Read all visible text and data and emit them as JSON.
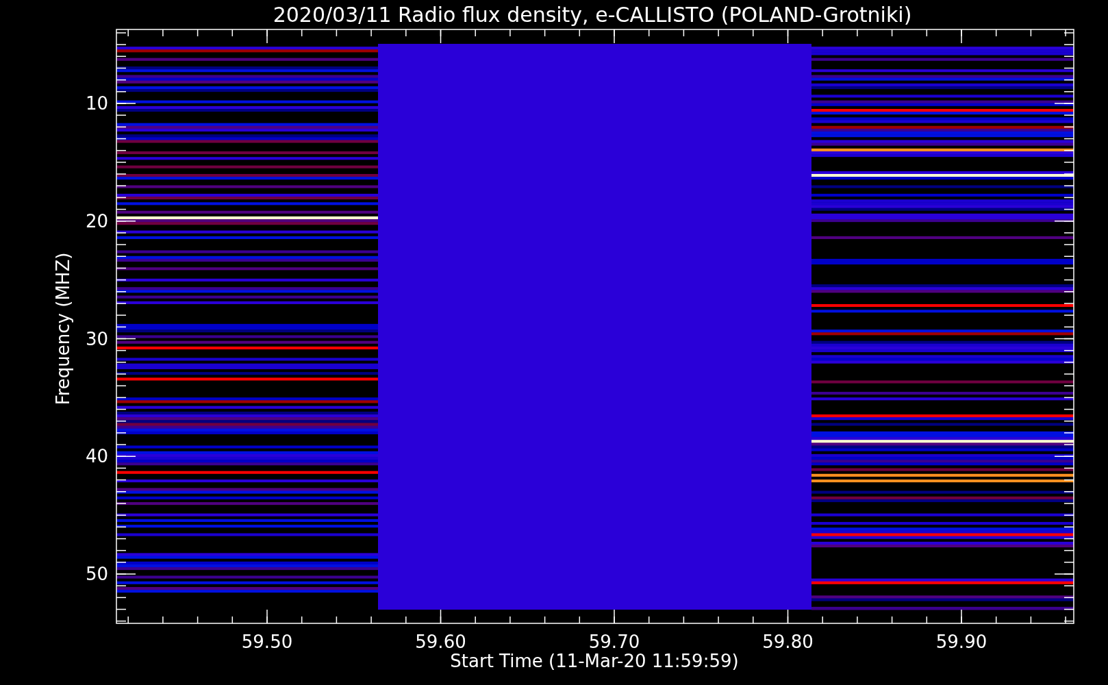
{
  "chart": {
    "title": "2020/03/11  Radio flux density, e-CALLISTO (POLAND-Grotniki)",
    "x_axis": {
      "label": "Start Time (11-Mar-20 11:59:59)",
      "tick_labels": [
        "59.50",
        "59.60",
        "59.70",
        "59.80",
        "59.90"
      ]
    },
    "y_axis": {
      "label": "Frequency (MHZ)",
      "tick_labels": [
        "10",
        "20",
        "30",
        "40",
        "50"
      ]
    }
  }
}
